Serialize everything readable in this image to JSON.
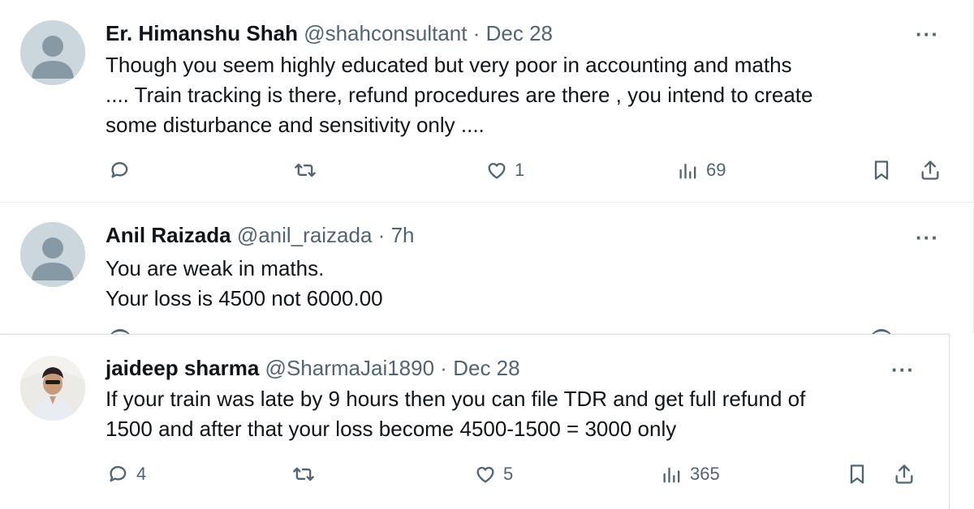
{
  "tweets": [
    {
      "name": "Er. Himanshu Shah",
      "handle": "@shahconsultant",
      "separator": "·",
      "time": "Dec 28",
      "more": "···",
      "body": "Though you seem highly educated but very poor in accounting and maths\n.... Train tracking is there, refund procedures are there , you intend to create\nsome disturbance and sensitivity only ....",
      "reply_count": "",
      "retweet_count": "",
      "like_count": "1",
      "views_count": "69"
    },
    {
      "name": "Anil Raizada",
      "handle": "@anil_raizada",
      "separator": "·",
      "time": "7h",
      "more": "···",
      "body": "You are weak in maths.\nYour loss is 4500 not 6000.00"
    },
    {
      "name": "jaideep sharma",
      "handle": "@SharmaJai1890",
      "separator": "·",
      "time": "Dec 28",
      "more": "···",
      "body": "If your train was late by 9 hours then you can file TDR and get full refund of\n1500 and after that your loss become 4500-1500 = 3000 only",
      "reply_count": "4",
      "retweet_count": "",
      "like_count": "5",
      "views_count": "365"
    }
  ],
  "icons": {
    "reply": "reply-icon",
    "retweet": "retweet-icon",
    "like": "heart-icon",
    "views": "views-icon",
    "bookmark": "bookmark-icon",
    "share": "share-icon"
  },
  "colors": {
    "text": "#0f1419",
    "secondary": "#536471",
    "avatar_bg": "#ccd6dd",
    "avatar_fg": "#8899a6"
  }
}
